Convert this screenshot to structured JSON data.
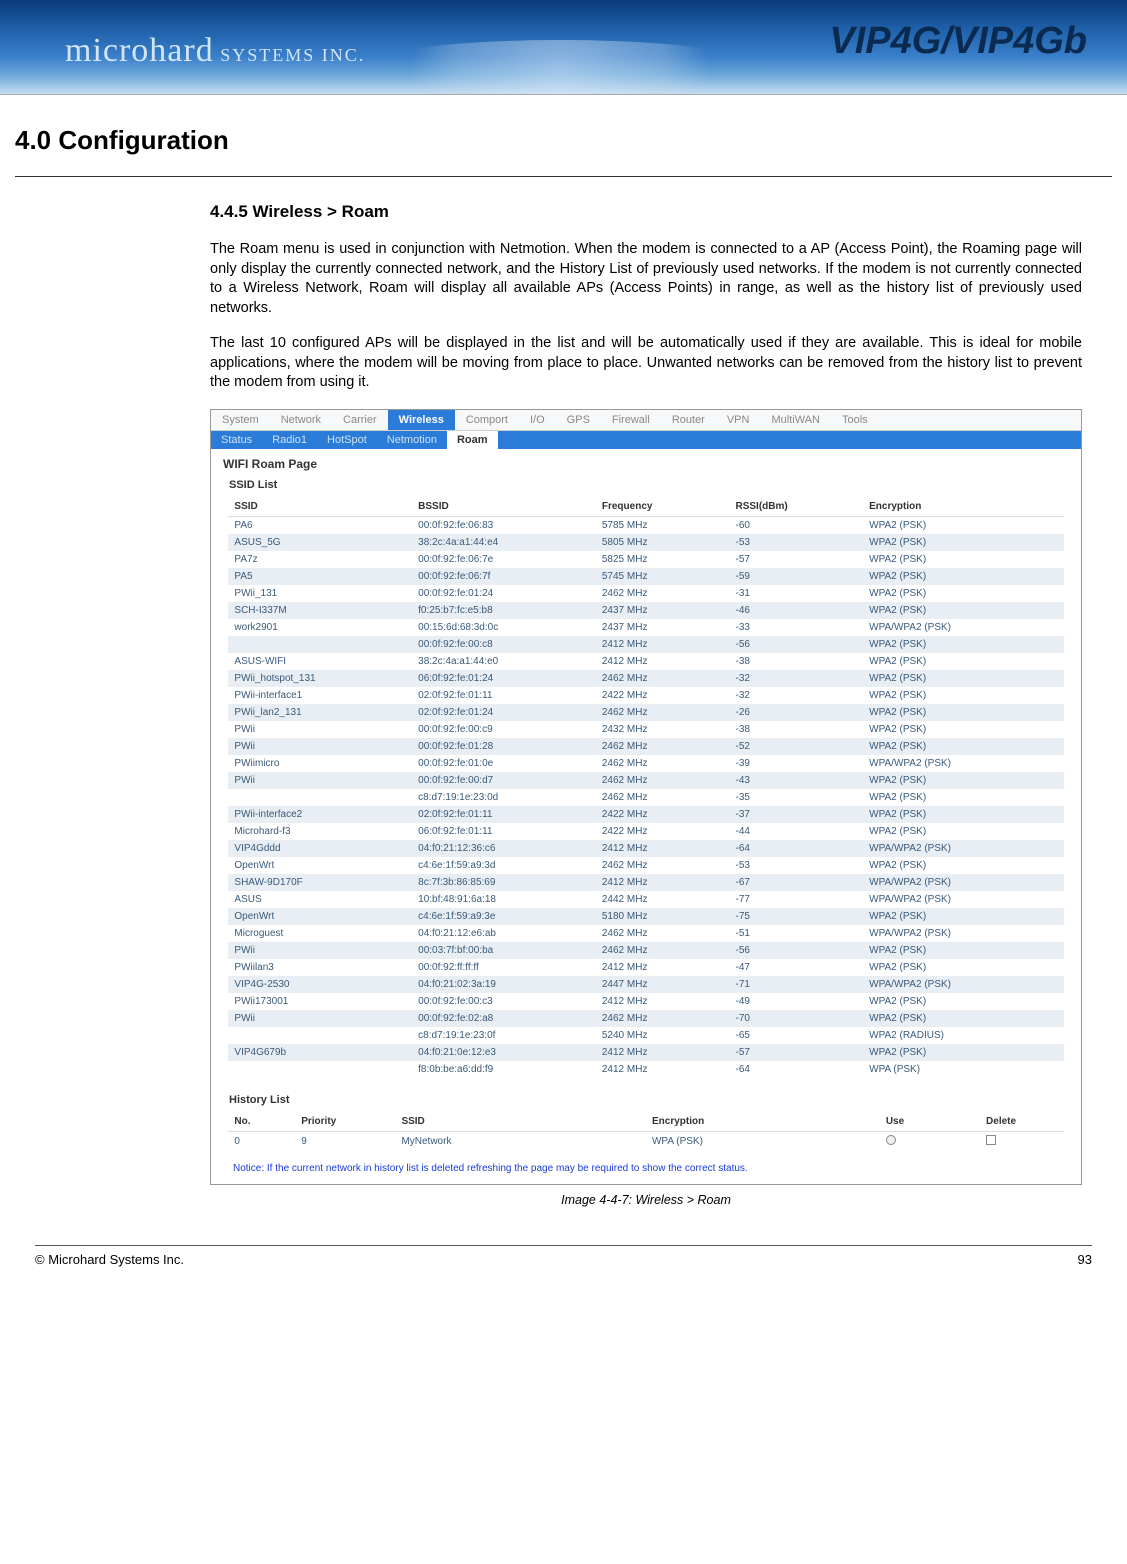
{
  "header": {
    "brand_main": "microhard",
    "brand_sub": " SYSTEMS INC.",
    "product": "VIP4G/VIP4Gb"
  },
  "section_title": "4.0  Configuration",
  "subheading": "4.4.5 Wireless > Roam",
  "para1": "The Roam menu is used in conjunction with Netmotion. When the modem is connected to a AP (Access Point), the Roaming page will only display the currently connected network, and the History List of previously used networks. If the modem is not currently connected to a Wireless Network, Roam will display all available APs (Access Points) in range, as well as the history list of previously used networks.",
  "para2": "The last 10 configured APs will be displayed in the list and will be automatically used if they are available. This is ideal for mobile applications, where the modem will be moving from place to place. Unwanted networks can be removed from the history list to prevent the modem from using it.",
  "ui": {
    "top_menu": [
      "System",
      "Network",
      "Carrier",
      "Wireless",
      "Comport",
      "I/O",
      "GPS",
      "Firewall",
      "Router",
      "VPN",
      "MultiWAN",
      "Tools"
    ],
    "top_menu_active": "Wireless",
    "sub_menu": [
      "Status",
      "Radio1",
      "HotSpot",
      "Netmotion",
      "Roam"
    ],
    "sub_menu_active": "Roam",
    "panel_title": "WIFI Roam Page",
    "ssid_section": "SSID List",
    "ssid_headers": [
      "SSID",
      "BSSID",
      "Frequency",
      "RSSI(dBm)",
      "Encryption"
    ],
    "ssid_rows": [
      [
        "PA6",
        "00:0f:92:fe:06:83",
        "5785 MHz",
        "-60",
        "WPA2 (PSK)"
      ],
      [
        "ASUS_5G",
        "38:2c:4a:a1:44:e4",
        "5805 MHz",
        "-53",
        "WPA2 (PSK)"
      ],
      [
        "PA7z",
        "00:0f:92:fe:06:7e",
        "5825 MHz",
        "-57",
        "WPA2 (PSK)"
      ],
      [
        "PA5",
        "00:0f:92:fe:06:7f",
        "5745 MHz",
        "-59",
        "WPA2 (PSK)"
      ],
      [
        "PWii_131",
        "00:0f:92:fe:01:24",
        "2462 MHz",
        "-31",
        "WPA2 (PSK)"
      ],
      [
        "SCH-I337M",
        "f0:25:b7:fc:e5:b8",
        "2437 MHz",
        "-46",
        "WPA2 (PSK)"
      ],
      [
        "work2901",
        "00:15:6d:68:3d:0c",
        "2437 MHz",
        "-33",
        "WPA/WPA2 (PSK)"
      ],
      [
        "",
        "00:0f:92:fe:00:c8",
        "2412 MHz",
        "-56",
        "WPA2 (PSK)"
      ],
      [
        "ASUS-WIFI",
        "38:2c:4a:a1:44:e0",
        "2412 MHz",
        "-38",
        "WPA2 (PSK)"
      ],
      [
        "PWii_hotspot_131",
        "06:0f:92:fe:01:24",
        "2462 MHz",
        "-32",
        "WPA2 (PSK)"
      ],
      [
        "PWii-interface1",
        "02:0f:92:fe:01:11",
        "2422 MHz",
        "-32",
        "WPA2 (PSK)"
      ],
      [
        "PWii_lan2_131",
        "02:0f:92:fe:01:24",
        "2462 MHz",
        "-26",
        "WPA2 (PSK)"
      ],
      [
        "PWii",
        "00:0f:92:fe:00:c9",
        "2432 MHz",
        "-38",
        "WPA2 (PSK)"
      ],
      [
        "PWii",
        "00:0f:92:fe:01:28",
        "2462 MHz",
        "-52",
        "WPA2 (PSK)"
      ],
      [
        "PWiimicro",
        "00:0f:92:fe:01:0e",
        "2462 MHz",
        "-39",
        "WPA/WPA2 (PSK)"
      ],
      [
        "PWii",
        "00:0f:92:fe:00:d7",
        "2462 MHz",
        "-43",
        "WPA2 (PSK)"
      ],
      [
        "",
        "c8:d7:19:1e:23:0d",
        "2462 MHz",
        "-35",
        "WPA2 (PSK)"
      ],
      [
        "PWii-interface2",
        "02:0f:92:fe:01:11",
        "2422 MHz",
        "-37",
        "WPA2 (PSK)"
      ],
      [
        "Microhard-f3",
        "06:0f:92:fe:01:11",
        "2422 MHz",
        "-44",
        "WPA2 (PSK)"
      ],
      [
        "VIP4Gddd",
        "04:f0:21:12:36:c6",
        "2412 MHz",
        "-64",
        "WPA/WPA2 (PSK)"
      ],
      [
        "OpenWrt",
        "c4:6e:1f:59:a9:3d",
        "2462 MHz",
        "-53",
        "WPA2 (PSK)"
      ],
      [
        "SHAW-9D170F",
        "8c:7f:3b:86:85:69",
        "2412 MHz",
        "-67",
        "WPA/WPA2 (PSK)"
      ],
      [
        "ASUS",
        "10:bf:48:91:6a:18",
        "2442 MHz",
        "-77",
        "WPA/WPA2 (PSK)"
      ],
      [
        "OpenWrt",
        "c4:6e:1f:59:a9:3e",
        "5180 MHz",
        "-75",
        "WPA2 (PSK)"
      ],
      [
        "Microguest",
        "04:f0:21:12:e6:ab",
        "2462 MHz",
        "-51",
        "WPA/WPA2 (PSK)"
      ],
      [
        "PWii",
        "00:03:7f:bf:00:ba",
        "2462 MHz",
        "-56",
        "WPA2 (PSK)"
      ],
      [
        "PWiilan3",
        "00:0f:92:ff:ff:ff",
        "2412 MHz",
        "-47",
        "WPA2 (PSK)"
      ],
      [
        "VIP4G-2530",
        "04:f0:21:02:3a:19",
        "2447 MHz",
        "-71",
        "WPA/WPA2 (PSK)"
      ],
      [
        "PWii173001",
        "00:0f:92:fe:00:c3",
        "2412 MHz",
        "-49",
        "WPA2 (PSK)"
      ],
      [
        "PWii",
        "00:0f:92:fe:02:a8",
        "2462 MHz",
        "-70",
        "WPA2 (PSK)"
      ],
      [
        "",
        "c8:d7:19:1e:23:0f",
        "5240 MHz",
        "-65",
        "WPA2 (RADIUS)"
      ],
      [
        "VIP4G679b",
        "04:f0:21:0e:12:e3",
        "2412 MHz",
        "-57",
        "WPA2 (PSK)"
      ],
      [
        "",
        "f8:0b:be:a6:dd:f9",
        "2412 MHz",
        "-64",
        "WPA (PSK)"
      ]
    ],
    "history_section": "History List",
    "history_headers": [
      "No.",
      "Priority",
      "SSID",
      "Encryption",
      "Use",
      "Delete"
    ],
    "history_rows": [
      [
        "0",
        "9",
        "MyNetwork",
        "WPA (PSK)"
      ]
    ],
    "notice": "Notice: If the current network in history list is deleted refreshing the page may be required to show the correct status."
  },
  "caption": "Image 4-4-7:  Wireless  >  Roam",
  "footer": {
    "copyright": "© Microhard Systems Inc.",
    "page": "93"
  }
}
